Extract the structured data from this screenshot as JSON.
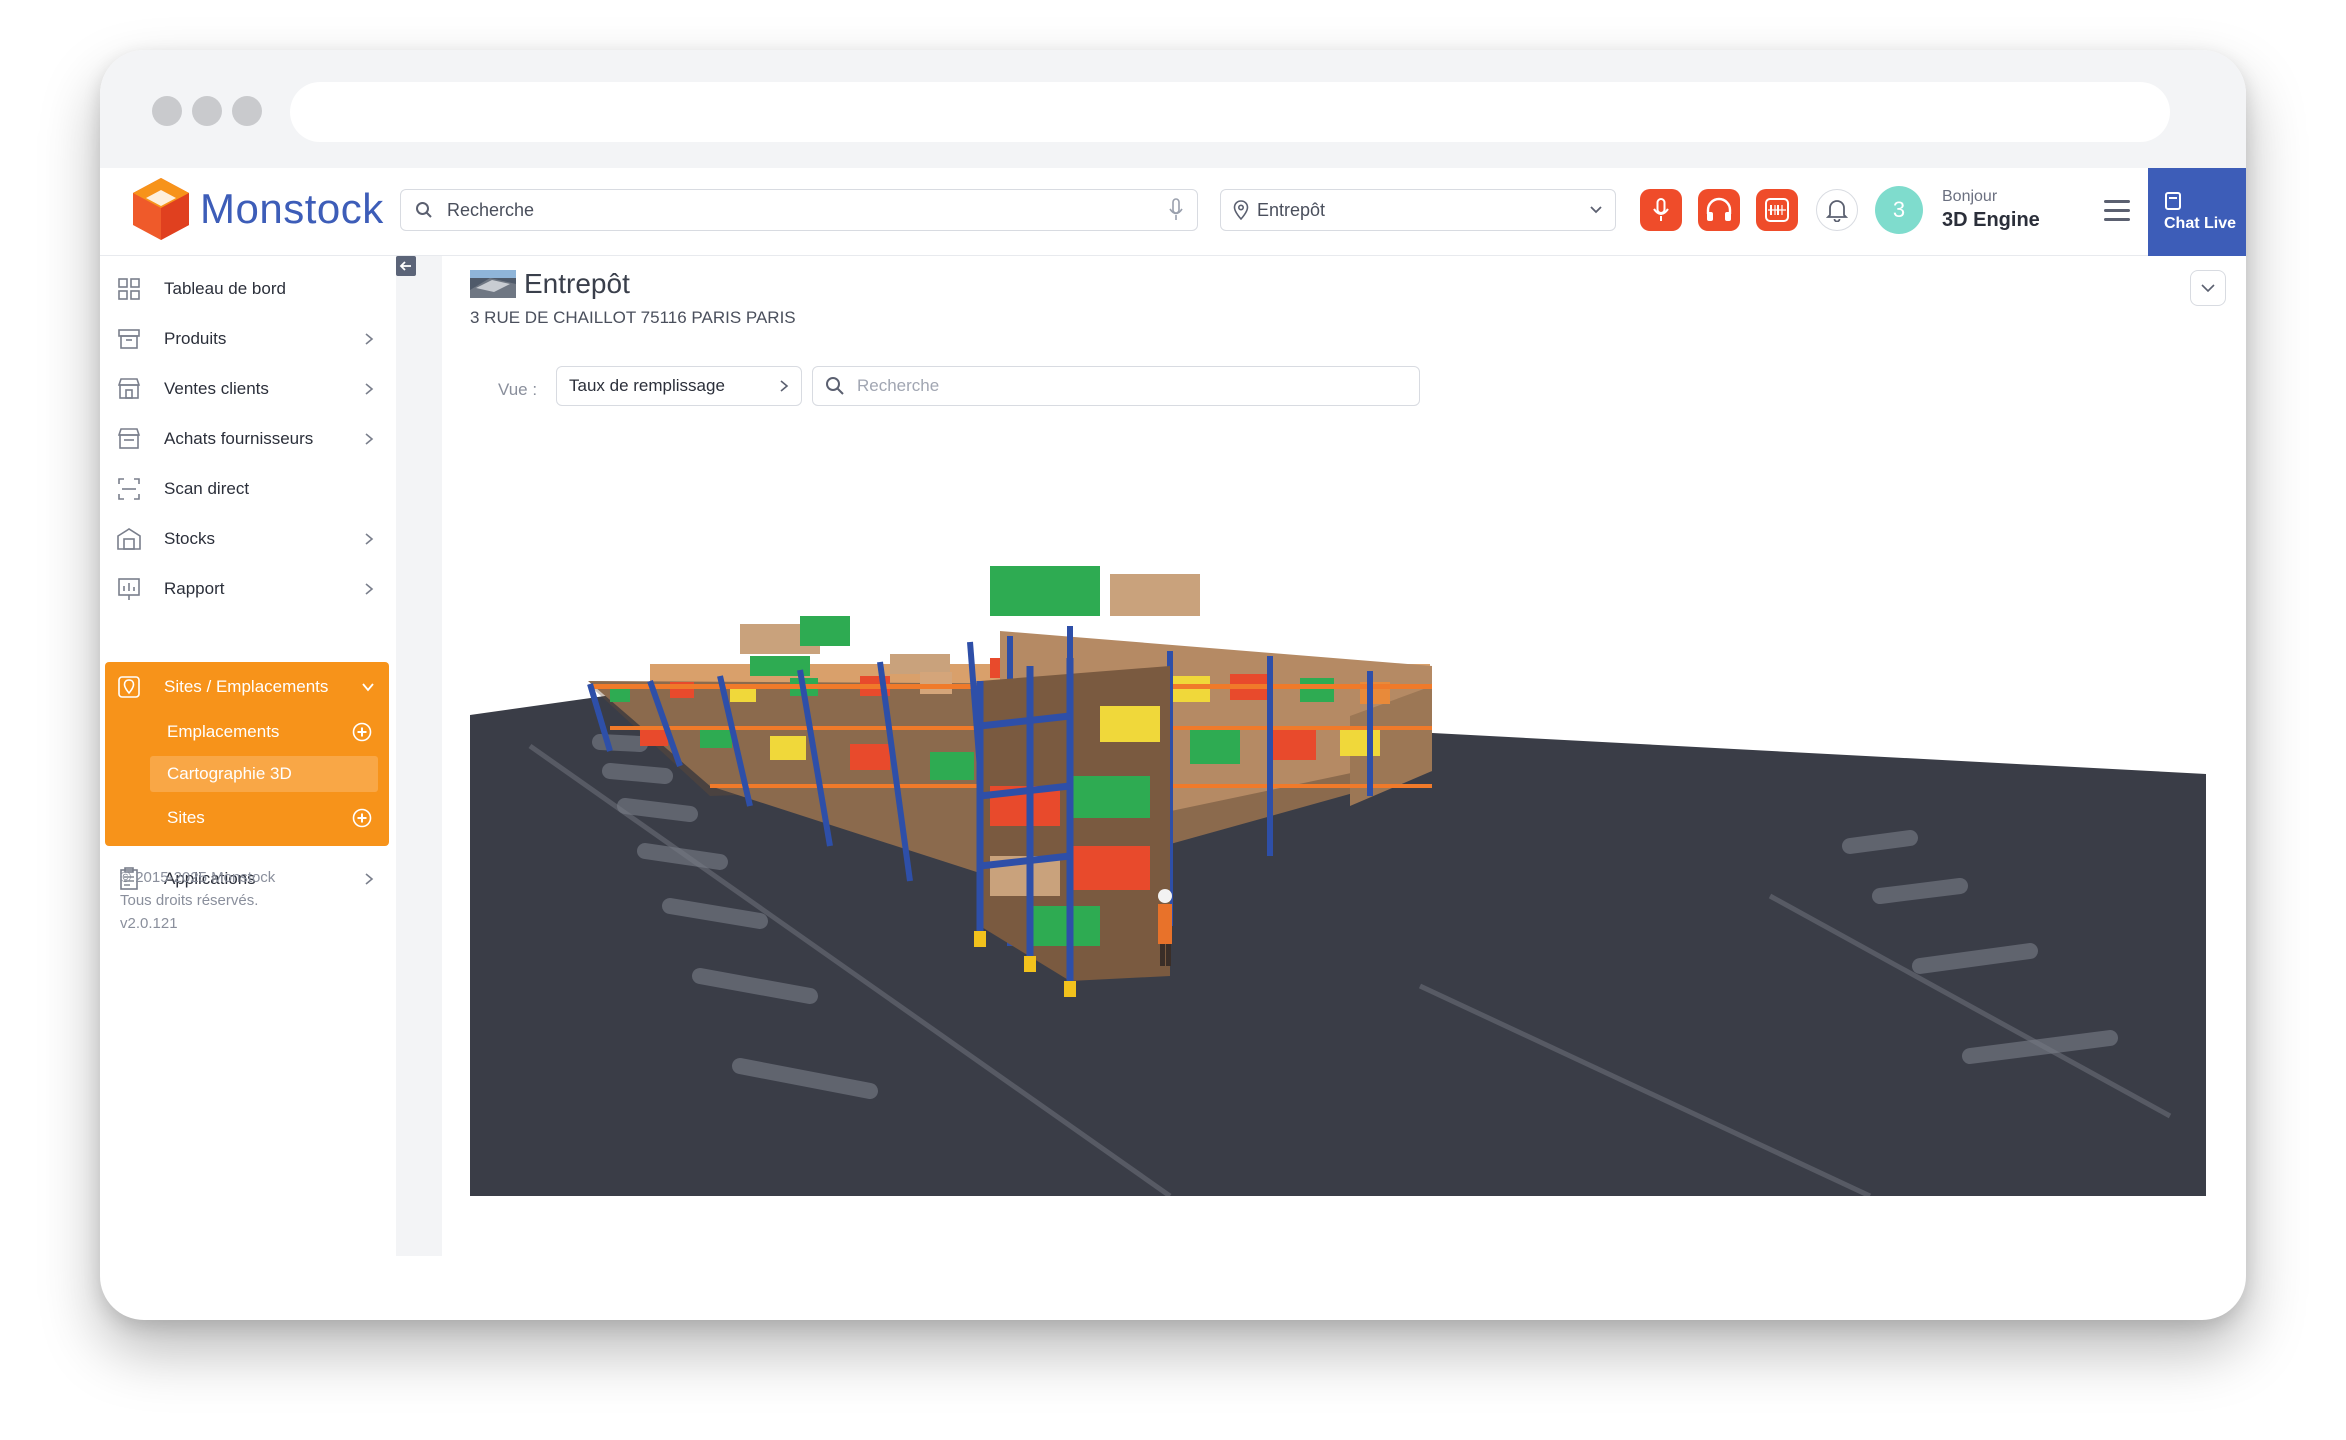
{
  "app": {
    "name": "Monstock"
  },
  "header": {
    "search_placeholder": "Recherche",
    "warehouse_select": "Entrepôt",
    "notifications_count": "3",
    "greeting": "Bonjour",
    "user_name": "3D Engine",
    "chat_label": "Chat Live"
  },
  "sidebar": {
    "items": [
      {
        "label": "Tableau de bord",
        "icon": "dashboard-icon"
      },
      {
        "label": "Produits",
        "icon": "box-icon"
      },
      {
        "label": "Ventes clients",
        "icon": "store-icon"
      },
      {
        "label": "Achats fournisseurs",
        "icon": "store-icon"
      },
      {
        "label": "Scan direct",
        "icon": "scan-icon"
      },
      {
        "label": "Stocks",
        "icon": "warehouse-icon"
      },
      {
        "label": "Rapport",
        "icon": "report-icon"
      }
    ],
    "active_section": {
      "label": "Sites / Emplacements",
      "children": [
        "Emplacements",
        "Cartographie 3D",
        "Sites"
      ]
    },
    "applications": "Applications",
    "copyright": [
      "© 2015-2025 Monstock",
      "Tous droits réservés.",
      "v2.0.121"
    ]
  },
  "main": {
    "title": "Entrepôt",
    "address": "3 RUE DE CHAILLOT 75116 PARIS PARIS",
    "view_label": "Vue :",
    "view_value": "Taux de remplissage",
    "search_placeholder": "Recherche"
  },
  "colors": {
    "accent_orange": "#f7931a",
    "brand_blue": "#3d5db8",
    "alert_red": "#ef4c2a",
    "floor": "#3a3d47"
  }
}
